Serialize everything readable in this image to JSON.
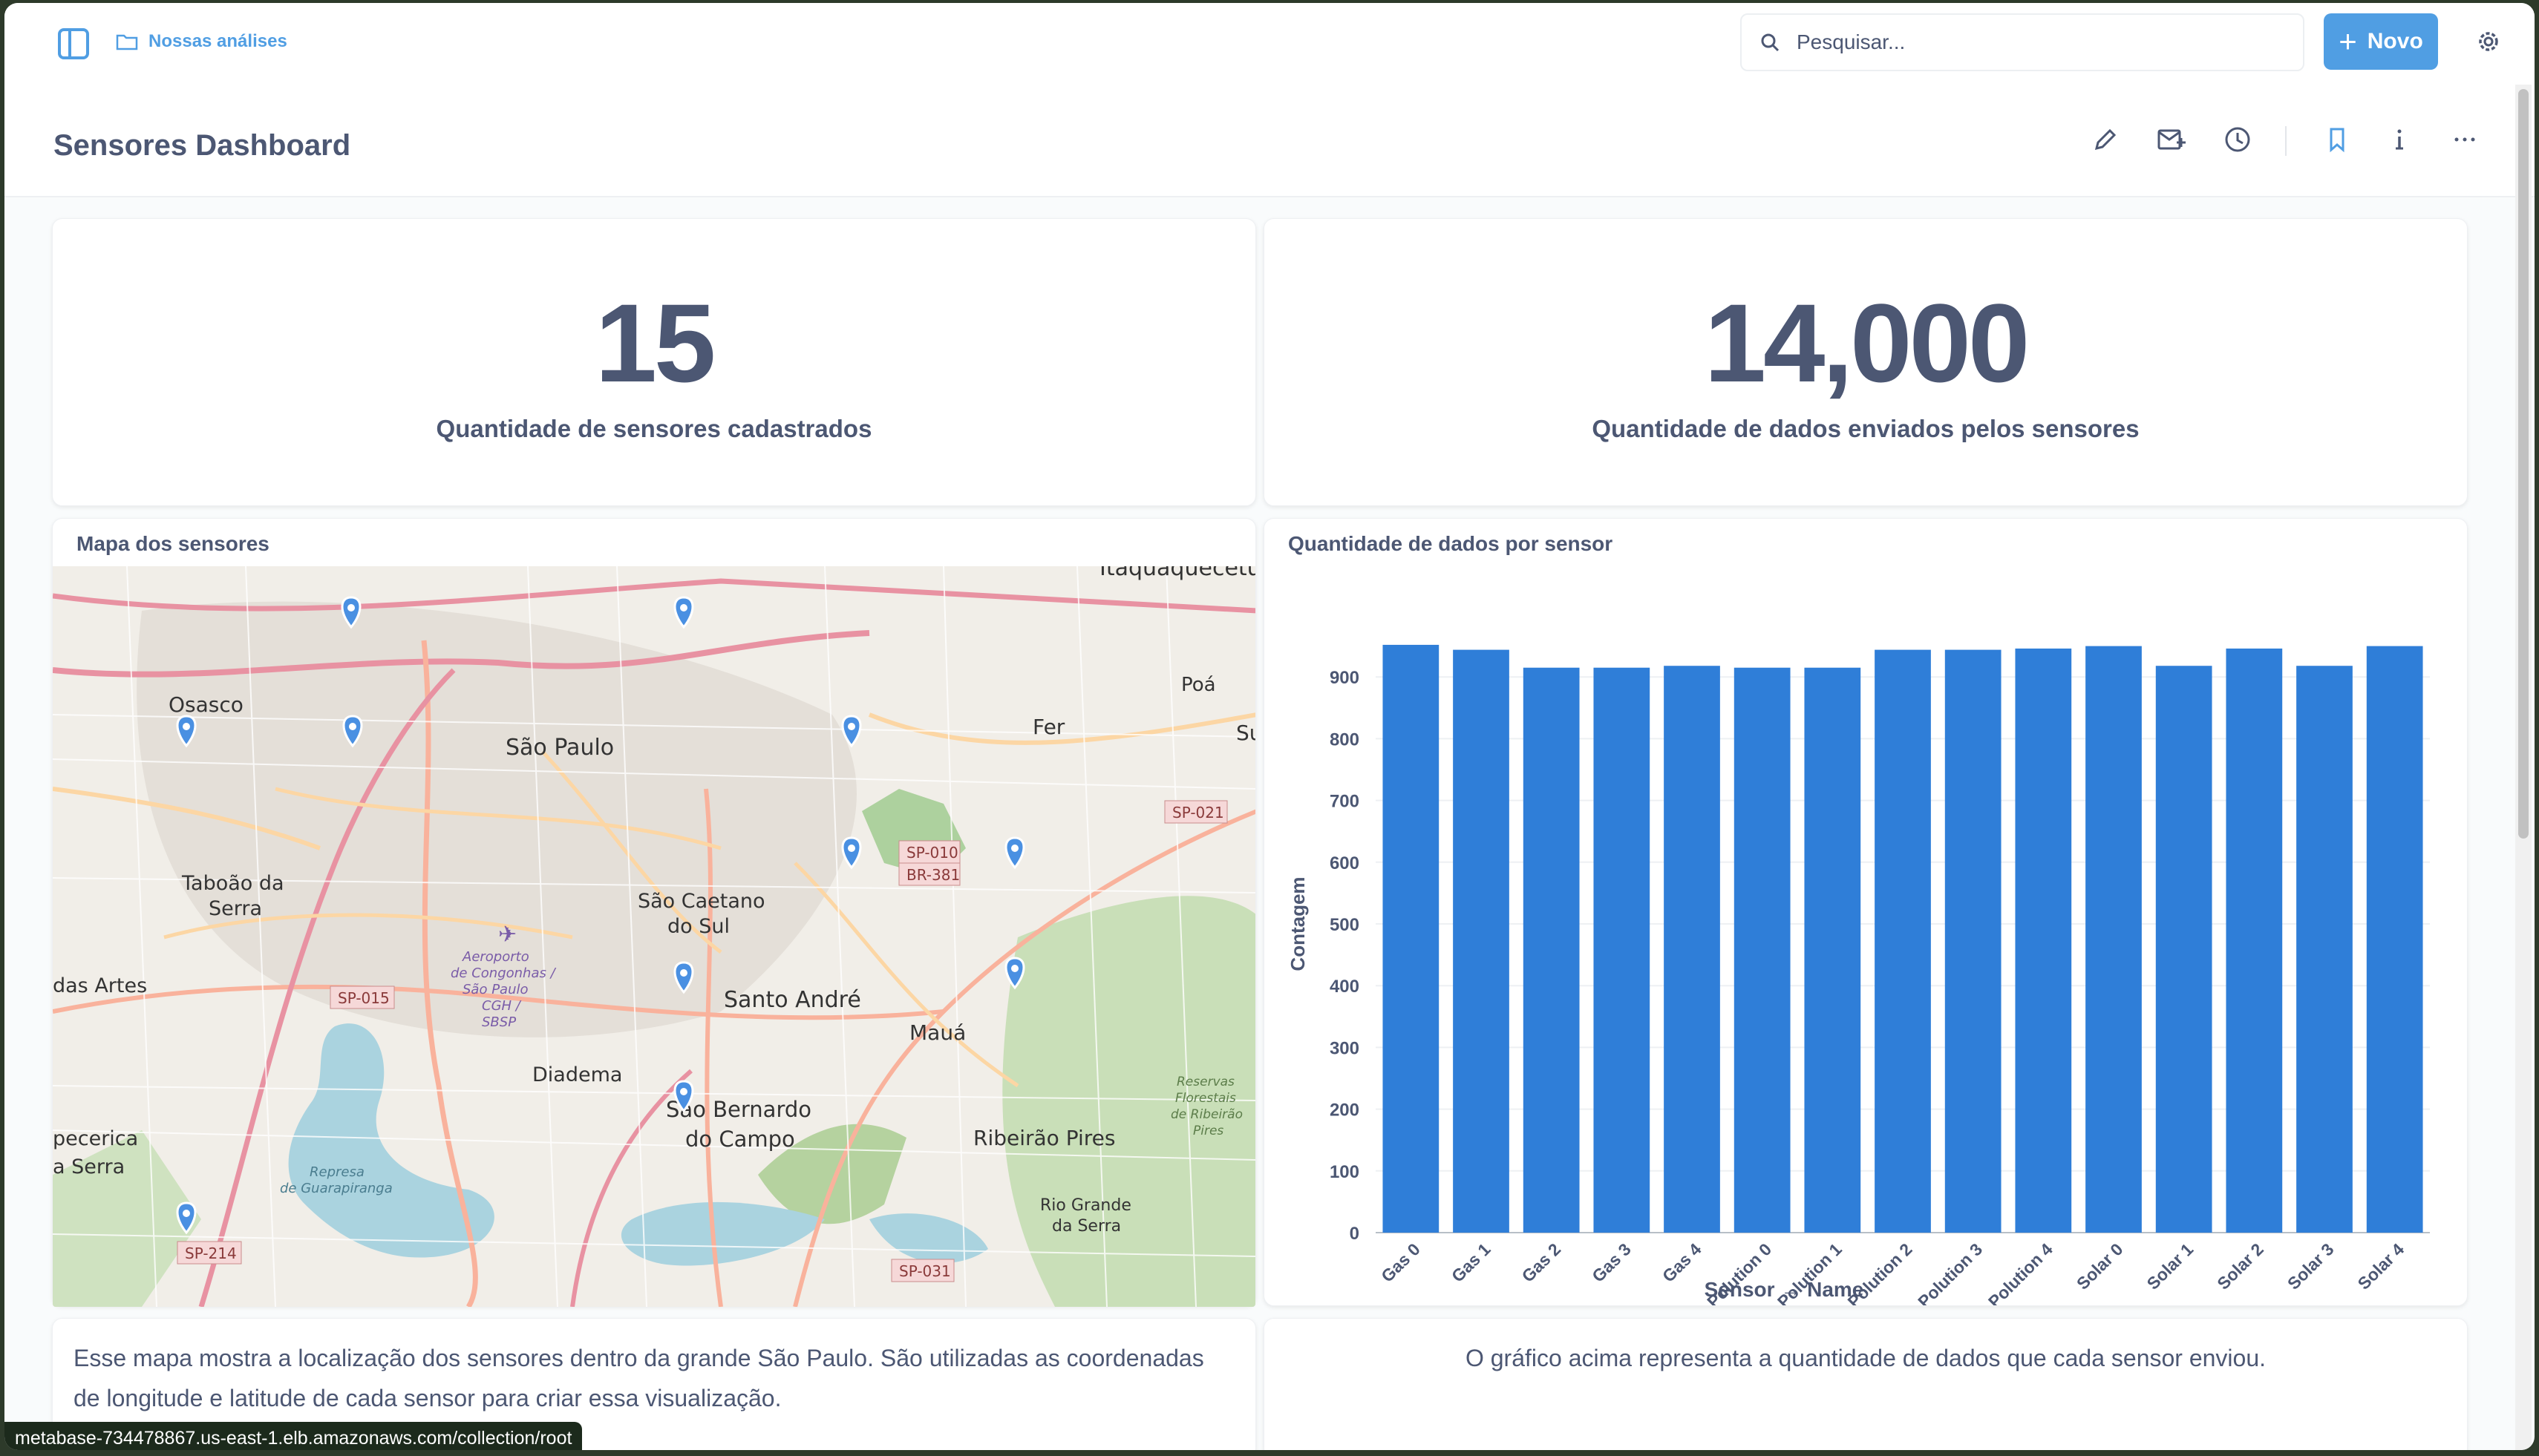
{
  "topbar": {
    "breadcrumb": "Nossas análises",
    "search_placeholder": "Pesquisar...",
    "new_button": "Novo"
  },
  "dashboard": {
    "title": "Sensores Dashboard"
  },
  "scalars": [
    {
      "value": "15",
      "label": "Quantidade de sensores cadastrados"
    },
    {
      "value": "14,000",
      "label": "Quantidade de dados enviados pelos sensores"
    }
  ],
  "map_card": {
    "title": "Mapa dos sensores",
    "labels": [
      "Itaquaquecetuba",
      "Osasco",
      "São Paulo",
      "Poá",
      "Fer",
      "Su",
      "Taboão da",
      "Serra",
      "das Artes",
      "São Caetano",
      "do Sul",
      "Santo André",
      "Mauá",
      "Diadema",
      "São Bernardo",
      "do Campo",
      "Ribeirão Pires",
      "Rio Grande",
      "da Serra",
      "pecerica",
      "a Serra",
      "Aeroporto",
      "de Congonhas /",
      "São Paulo",
      "CGH /",
      "SBSP",
      "Represa",
      "de Guarapiranga",
      "Reservas",
      "Florestais",
      "de Ribeirão",
      "Pires"
    ],
    "road_shields": [
      "SP-010",
      "BR-381",
      "SP-021",
      "SP-015",
      "SP-214",
      "SP-031"
    ]
  },
  "chart_card": {
    "title": "Quantidade de dados por sensor"
  },
  "chart_data": {
    "type": "bar",
    "title": "Quantidade de dados por sensor",
    "xlabel": "Sensor → Name",
    "ylabel": "Contagem",
    "categories": [
      "Gas 0",
      "Gas 1",
      "Gas 2",
      "Gas 3",
      "Gas 4",
      "Polution 0",
      "Polution 1",
      "Polution 2",
      "Polution 3",
      "Polution 4",
      "Solar 0",
      "Solar 1",
      "Solar 2",
      "Solar 3",
      "Solar 4"
    ],
    "values": [
      952,
      944,
      915,
      915,
      918,
      915,
      915,
      944,
      944,
      946,
      950,
      918,
      946,
      918,
      950
    ],
    "yticks": [
      0,
      100,
      200,
      300,
      400,
      500,
      600,
      700,
      800,
      900
    ],
    "ylim": [
      0,
      1000
    ],
    "bar_color": "#2f7ed8",
    "grid": true
  },
  "text_cards": {
    "map_description": "Esse mapa mostra a localização dos sensores dentro da grande São Paulo. São utilizadas as coordenadas de longitude e latitude de cada sensor para criar essa visualização.",
    "chart_description": "O gráfico acima representa a quantidade de dados que cada sensor enviou."
  },
  "status_url": "metabase-734478867.us-east-1.elb.amazonaws.com/collection/root",
  "colors": {
    "brand": "#509ee3",
    "text": "#4c5773",
    "bar": "#2f7ed8"
  }
}
